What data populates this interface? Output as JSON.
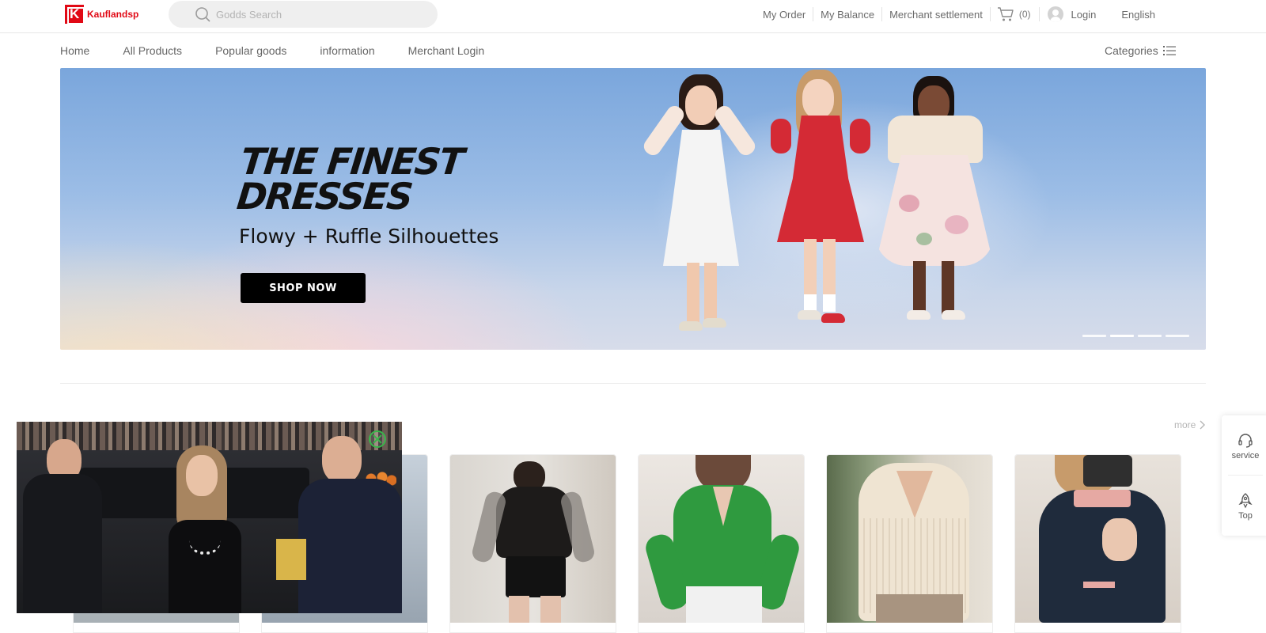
{
  "brand": {
    "name": "Kauflandsp"
  },
  "search": {
    "placeholder": "Godds Search"
  },
  "toplinks": {
    "my_order": "My Order",
    "my_balance": "My Balance",
    "merchant_settlement": "Merchant settlement",
    "cart_count": "(0)",
    "login": "Login",
    "language": "English"
  },
  "nav": {
    "items": [
      {
        "label": "Home"
      },
      {
        "label": "All Products"
      },
      {
        "label": "Popular goods"
      },
      {
        "label": "information"
      },
      {
        "label": "Merchant Login"
      }
    ],
    "categories": "Categories"
  },
  "banner": {
    "headline_line1": "THE FINEST",
    "headline_line2": "DRESSES",
    "subtitle": "Flowy + Ruffle Silhouettes",
    "cta": "SHOP NOW",
    "slides_total": 4,
    "active_slide": 2
  },
  "section": {
    "more": "more"
  },
  "products": [
    {
      "depicts": "partially hidden product"
    },
    {
      "depicts": "partially hidden product"
    },
    {
      "depicts": "black corset top with lace sleeves and leather shorts"
    },
    {
      "depicts": "green henley long sleeve top"
    },
    {
      "depicts": "cream ribbed knit polo sweater"
    },
    {
      "depicts": "navy knit polo sweater with stripe collar"
    }
  ],
  "side": {
    "service": "service",
    "top": "Top"
  },
  "icons": {
    "search": "search-icon",
    "cart": "cart-icon",
    "user": "user-icon",
    "list": "list-icon",
    "chevron": "chevron-right-icon",
    "headset": "headset-icon",
    "rocket": "rocket-icon",
    "close": "close-icon"
  },
  "colors": {
    "brand_red": "#e10915",
    "close_green": "#39b54a"
  }
}
